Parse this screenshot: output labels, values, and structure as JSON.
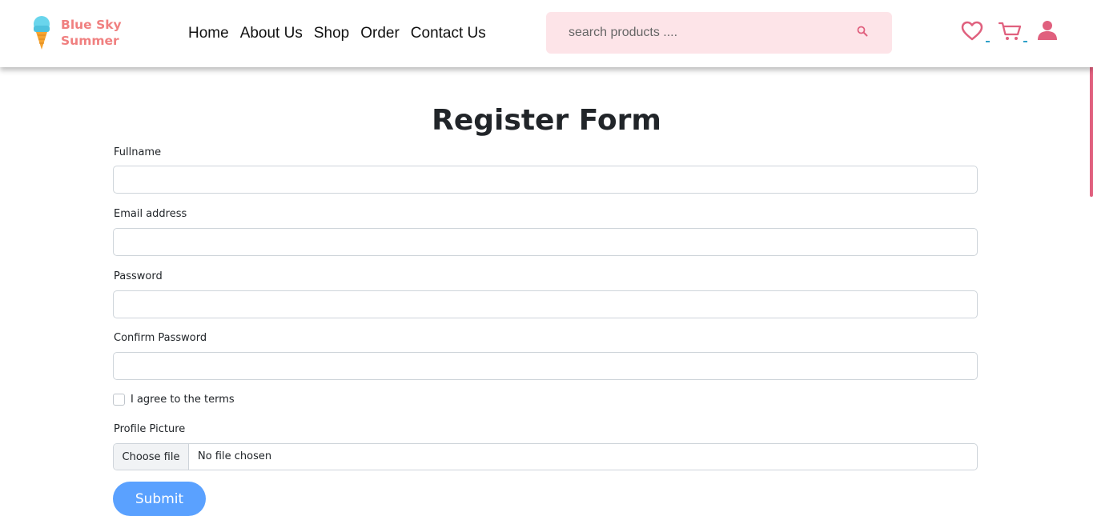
{
  "brand": {
    "name_line1": "Blue Sky",
    "name_line2": "Summer",
    "color": "#f08080",
    "icon": "ice-cream-cone-icon"
  },
  "nav": {
    "links": [
      "Home",
      "About Us",
      "Shop",
      "Order",
      "Contact Us"
    ]
  },
  "search": {
    "placeholder": "search products ....",
    "icon": "search-icon",
    "background": "#fde4e8"
  },
  "header_icons": {
    "wishlist": "heart-icon",
    "cart": "cart-icon",
    "account": "user-icon",
    "accent": "#e0607e"
  },
  "form": {
    "title": "Register Form",
    "fields": [
      {
        "label": "Fullname",
        "value": ""
      },
      {
        "label": "Email address",
        "value": ""
      },
      {
        "label": "Password",
        "value": ""
      },
      {
        "label": "Confirm Password",
        "value": ""
      }
    ],
    "terms_label": "I agree to the terms",
    "terms_checked": false,
    "profile_picture_label": "Profile Picture",
    "file_button_label": "Choose file",
    "file_status": "No file chosen",
    "submit_label": "Submit",
    "submit_color": "#5aa1ff"
  }
}
